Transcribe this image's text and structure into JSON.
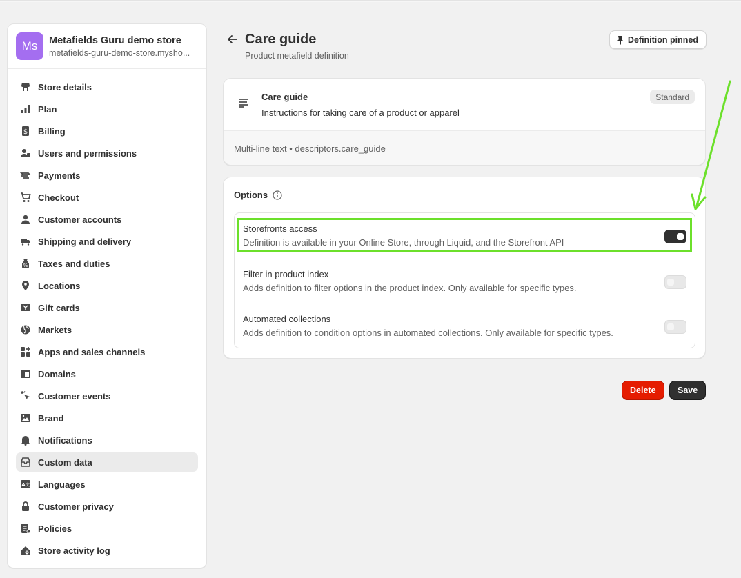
{
  "store": {
    "initials": "Ms",
    "name": "Metafields Guru demo store",
    "domain": "metafields-guru-demo-store.mysho..."
  },
  "sidebar": {
    "items": [
      {
        "label": "Store details",
        "icon": "store-icon"
      },
      {
        "label": "Plan",
        "icon": "plan-icon"
      },
      {
        "label": "Billing",
        "icon": "billing-icon"
      },
      {
        "label": "Users and permissions",
        "icon": "users-icon"
      },
      {
        "label": "Payments",
        "icon": "payments-icon"
      },
      {
        "label": "Checkout",
        "icon": "cart-icon"
      },
      {
        "label": "Customer accounts",
        "icon": "person-icon"
      },
      {
        "label": "Shipping and delivery",
        "icon": "truck-icon"
      },
      {
        "label": "Taxes and duties",
        "icon": "taxes-icon"
      },
      {
        "label": "Locations",
        "icon": "location-icon"
      },
      {
        "label": "Gift cards",
        "icon": "gift-card-icon"
      },
      {
        "label": "Markets",
        "icon": "globe-icon"
      },
      {
        "label": "Apps and sales channels",
        "icon": "apps-icon"
      },
      {
        "label": "Domains",
        "icon": "domains-icon"
      },
      {
        "label": "Customer events",
        "icon": "cursor-icon"
      },
      {
        "label": "Brand",
        "icon": "brand-icon"
      },
      {
        "label": "Notifications",
        "icon": "bell-icon"
      },
      {
        "label": "Custom data",
        "icon": "custom-data-icon",
        "active": true
      },
      {
        "label": "Languages",
        "icon": "languages-icon"
      },
      {
        "label": "Customer privacy",
        "icon": "lock-icon"
      },
      {
        "label": "Policies",
        "icon": "policies-icon"
      },
      {
        "label": "Store activity log",
        "icon": "activity-log-icon"
      }
    ]
  },
  "header": {
    "title": "Care guide",
    "subtitle": "Product metafield definition",
    "pin_label": "Definition pinned"
  },
  "definition": {
    "name": "Care guide",
    "description": "Instructions for taking care of a product or apparel",
    "badge": "Standard",
    "type_line": "Multi-line text • descriptors.care_guide"
  },
  "options": {
    "title": "Options",
    "rows": [
      {
        "name": "Storefronts access",
        "description": "Definition is available in your Online Store, through Liquid, and the Storefront API",
        "enabled": true
      },
      {
        "name": "Filter in product index",
        "description": "Adds definition to filter options in the product index. Only available for specific types.",
        "enabled": false
      },
      {
        "name": "Automated collections",
        "description": "Adds definition to condition options in automated collections. Only available for specific types.",
        "enabled": false
      }
    ]
  },
  "actions": {
    "delete_label": "Delete",
    "save_label": "Save"
  },
  "colors": {
    "highlight": "#6ce02b",
    "avatar": "#a46ef0",
    "delete": "#e51c00"
  }
}
